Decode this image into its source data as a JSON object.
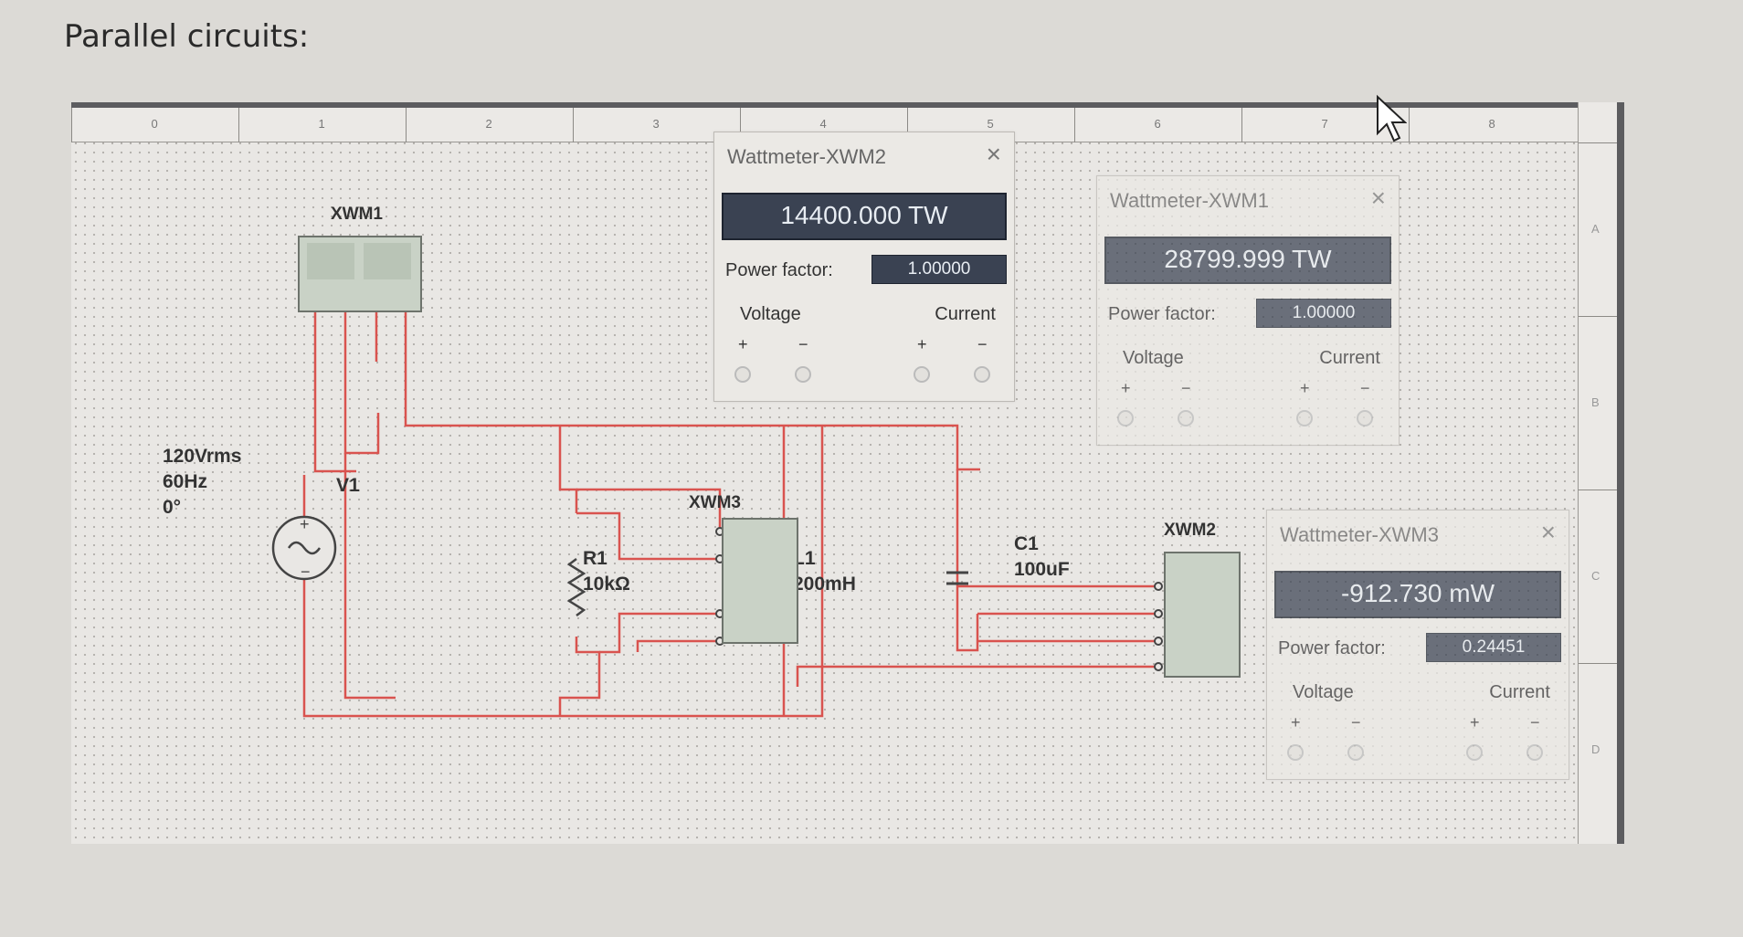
{
  "page": {
    "title": "Parallel circuits:"
  },
  "ruler": {
    "top_labels": [
      "0",
      "1",
      "2",
      "3",
      "4",
      "5",
      "6",
      "7",
      "8"
    ],
    "right_labels": [
      "A",
      "B",
      "C",
      "D"
    ]
  },
  "source": {
    "name": "V1",
    "voltage": "120Vrms",
    "frequency": "60Hz",
    "phase": "0°"
  },
  "components": {
    "r1": {
      "name": "R1",
      "value": "10kΩ"
    },
    "l1": {
      "name": "L1",
      "value": "200mH"
    },
    "c1": {
      "name": "C1",
      "value": "100uF"
    }
  },
  "meters_on_schematic": {
    "xwm1": "XWM1",
    "xwm2": "XWM2",
    "xwm3": "XWM3"
  },
  "dialogs": [
    {
      "title": "Wattmeter-XWM2",
      "reading": "14400.000 TW",
      "pf_label": "Power factor:",
      "power_factor": "1.00000",
      "voltage_label": "Voltage",
      "current_label": "Current",
      "plus": "+",
      "minus": "−"
    },
    {
      "title": "Wattmeter-XWM1",
      "reading": "28799.999 TW",
      "pf_label": "Power factor:",
      "power_factor": "1.00000",
      "voltage_label": "Voltage",
      "current_label": "Current",
      "plus": "+",
      "minus": "−"
    },
    {
      "title": "Wattmeter-XWM3",
      "reading": "-912.730 mW",
      "pf_label": "Power factor:",
      "power_factor": "0.24451",
      "voltage_label": "Voltage",
      "current_label": "Current",
      "plus": "+",
      "minus": "−"
    }
  ],
  "close_glyph": "×",
  "colors": {
    "wire": "#d9534f",
    "display_bg": "#3a4252",
    "meter_body": "#c9d2c6"
  }
}
